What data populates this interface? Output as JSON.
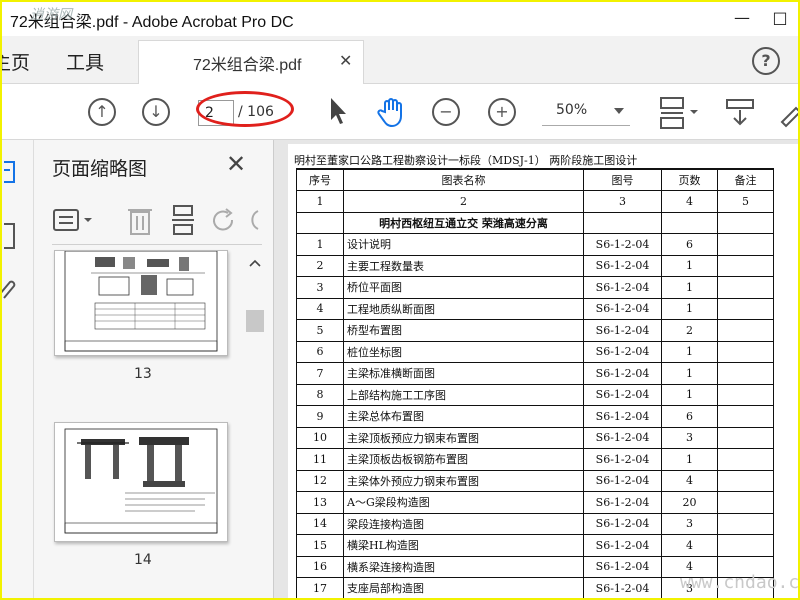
{
  "window": {
    "title": "72米组合梁.pdf - Adobe Acrobat Pro DC",
    "watermark_top": "逍游网"
  },
  "tabs": {
    "home_partial": "主页",
    "tools": "工具",
    "document": "72米组合梁.pdf"
  },
  "toolbar": {
    "current_page": "2",
    "total_pages": "/ 106",
    "zoom": "50%"
  },
  "panel": {
    "title": "页面缩略图",
    "thumbnails": [
      {
        "number": "13"
      },
      {
        "number": "14"
      }
    ]
  },
  "document": {
    "heading": "明村至董家口公路工程勘察设计一标段（MDSJ-1） 两阶段施工图设计",
    "columns": [
      "序号",
      "图表名称",
      "图号",
      "页数",
      "备注"
    ],
    "column_numbers": [
      "1",
      "2",
      "3",
      "4",
      "5"
    ],
    "section_title": "明村西枢纽互通立交 荣潍高速分离",
    "rows": [
      {
        "no": "1",
        "name": "设计说明",
        "code": "S6-1-2-04",
        "pages": "6"
      },
      {
        "no": "2",
        "name": "主要工程数量表",
        "code": "S6-1-2-04",
        "pages": "1"
      },
      {
        "no": "3",
        "name": "桥位平面图",
        "code": "S6-1-2-04",
        "pages": "1"
      },
      {
        "no": "4",
        "name": "工程地质纵断面图",
        "code": "S6-1-2-04",
        "pages": "1"
      },
      {
        "no": "5",
        "name": "桥型布置图",
        "code": "S6-1-2-04",
        "pages": "2"
      },
      {
        "no": "6",
        "name": "桩位坐标图",
        "code": "S6-1-2-04",
        "pages": "1"
      },
      {
        "no": "7",
        "name": "主梁标准横断面图",
        "code": "S6-1-2-04",
        "pages": "1"
      },
      {
        "no": "8",
        "name": "上部结构施工工序图",
        "code": "S6-1-2-04",
        "pages": "1"
      },
      {
        "no": "9",
        "name": "主梁总体布置图",
        "code": "S6-1-2-04",
        "pages": "6"
      },
      {
        "no": "10",
        "name": "主梁顶板预应力钢束布置图",
        "code": "S6-1-2-04",
        "pages": "3"
      },
      {
        "no": "11",
        "name": "主梁顶板齿板钢筋布置图",
        "code": "S6-1-2-04",
        "pages": "1"
      },
      {
        "no": "12",
        "name": "主梁体外预应力钢束布置图",
        "code": "S6-1-2-04",
        "pages": "4"
      },
      {
        "no": "13",
        "name": "A～G梁段构造图",
        "code": "S6-1-2-04",
        "pages": "20"
      },
      {
        "no": "14",
        "name": "梁段连接构造图",
        "code": "S6-1-2-04",
        "pages": "3"
      },
      {
        "no": "15",
        "name": "横梁HL构造图",
        "code": "S6-1-2-04",
        "pages": "4"
      },
      {
        "no": "16",
        "name": "横系梁连接构造图",
        "code": "S6-1-2-04",
        "pages": "4"
      },
      {
        "no": "17",
        "name": "支座局部构造图",
        "code": "S6-1-2-04",
        "pages": "3"
      }
    ]
  },
  "site_watermark": "www.cndao.com",
  "colors": {
    "frame": "#f2f200",
    "callout": "#e0201c",
    "tab_bg": "#f2f2f2"
  }
}
